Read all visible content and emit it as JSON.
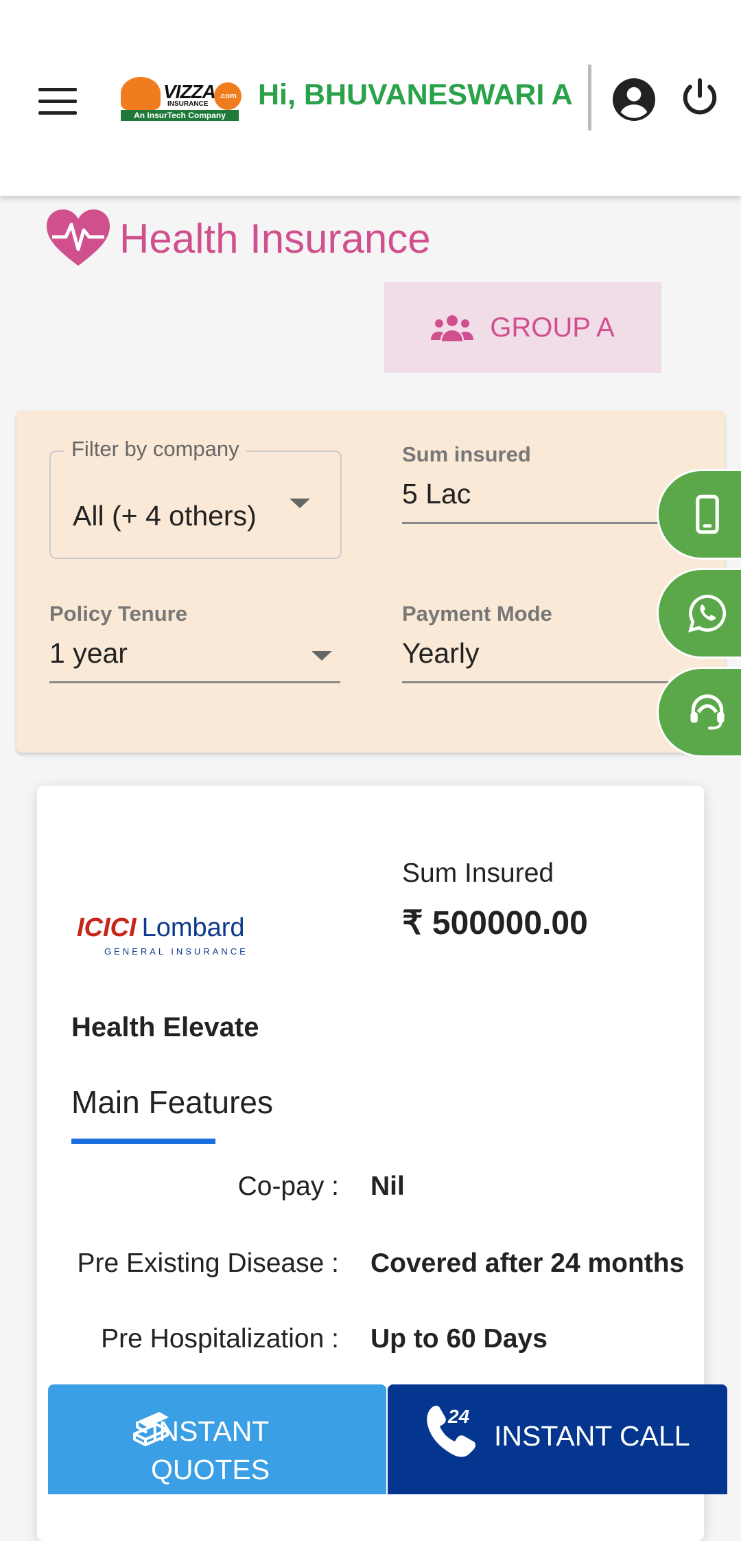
{
  "header": {
    "logo_text": "VIZZA",
    "logo_sub": "INSURANCE",
    "logo_tagline": "An InsurTech Company",
    "logo_com": ".com",
    "greeting": "Hi, BHUVANESWARI A"
  },
  "page": {
    "title": "Health Insurance",
    "group_label": "GROUP A"
  },
  "filters": {
    "company_label": "Filter by company",
    "company_value": "All (+ 4 others)",
    "sum_label": "Sum insured",
    "sum_value": "5 Lac",
    "tenure_label": "Policy Tenure",
    "tenure_value": "1 year",
    "payment_label": "Payment Mode",
    "payment_value": "Yearly"
  },
  "floating_buttons": [
    "mobile-icon",
    "whatsapp-icon",
    "support-agent-icon"
  ],
  "card": {
    "insurer_logo_main": "ICICI",
    "insurer_logo_brand": "Lombard",
    "insurer_logo_sub": "GENERAL INSURANCE",
    "sum_label": "Sum Insured",
    "sum_value": "₹ 500000.00",
    "plan_name": "Health Elevate",
    "tab_label": "Main Features",
    "features": [
      {
        "label": "Co-pay :",
        "value": "Nil"
      },
      {
        "label": "Pre Existing Disease :",
        "value": "Covered after 24 months"
      },
      {
        "label": "Pre Hospitalization :",
        "value": "Up to 60 Days"
      }
    ]
  },
  "bottom_bar": {
    "quotes_label": "INSTANT QUOTES",
    "call_label": "INSTANT CALL",
    "call_badge": "24"
  },
  "colors": {
    "brand_green": "#2aa24a",
    "brand_pink": "#d0508e",
    "panel_bg": "#f9e9d6",
    "quotes_blue": "#3a9fe4",
    "call_navy": "#043690"
  }
}
